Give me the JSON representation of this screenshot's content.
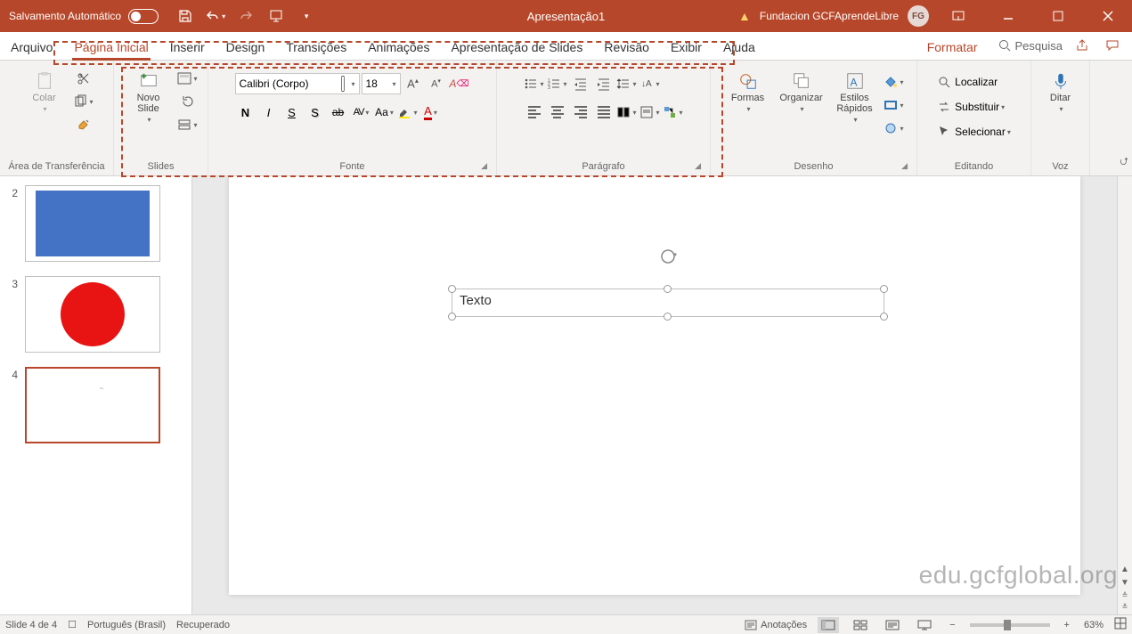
{
  "titlebar": {
    "autosave_label": "Salvamento Automático",
    "center_title": "Apresentação1",
    "account_name": "Fundacion GCFAprendeLibre",
    "account_initials": "FG"
  },
  "menubar": {
    "tabs": [
      "Arquivo",
      "Página Inicial",
      "Inserir",
      "Design",
      "Transições",
      "Animações",
      "Apresentação de Slides",
      "Revisão",
      "Exibir",
      "Ajuda"
    ],
    "format_tab": "Formatar",
    "search_label": "Pesquisa"
  },
  "ribbon": {
    "clipboard": {
      "label": "Área de Transferência",
      "paste": "Colar"
    },
    "slides": {
      "label": "Slides",
      "new_slide": "Novo Slide"
    },
    "font": {
      "label": "Fonte",
      "font_name": "Calibri (Corpo)",
      "font_size": "18",
      "bold": "N",
      "italic": "I",
      "underline": "S",
      "strike": "S",
      "strike2": "ab",
      "spacing": "AV",
      "case": "Aa"
    },
    "paragraph": {
      "label": "Parágrafo"
    },
    "drawing": {
      "label": "Desenho",
      "shapes": "Formas",
      "arrange": "Organizar",
      "quick_styles_l1": "Estilos",
      "quick_styles_l2": "Rápidos"
    },
    "editing": {
      "label": "Editando",
      "find": "Localizar",
      "replace": "Substituir",
      "select": "Selecionar"
    },
    "voice": {
      "label": "Voz",
      "dictate": "Ditar"
    }
  },
  "slides": [
    {
      "num": "2",
      "kind": "blue-rect"
    },
    {
      "num": "3",
      "kind": "red-circle"
    },
    {
      "num": "4",
      "kind": "blank",
      "selected": true
    }
  ],
  "canvas": {
    "textbox_content": "Texto"
  },
  "statusbar": {
    "slide_counter": "Slide 4 de 4",
    "language": "Português (Brasil)",
    "recovered": "Recuperado",
    "notes": "Anotações",
    "zoom": "63%"
  },
  "watermark": "edu.gcfglobal.org",
  "chart_data": null
}
